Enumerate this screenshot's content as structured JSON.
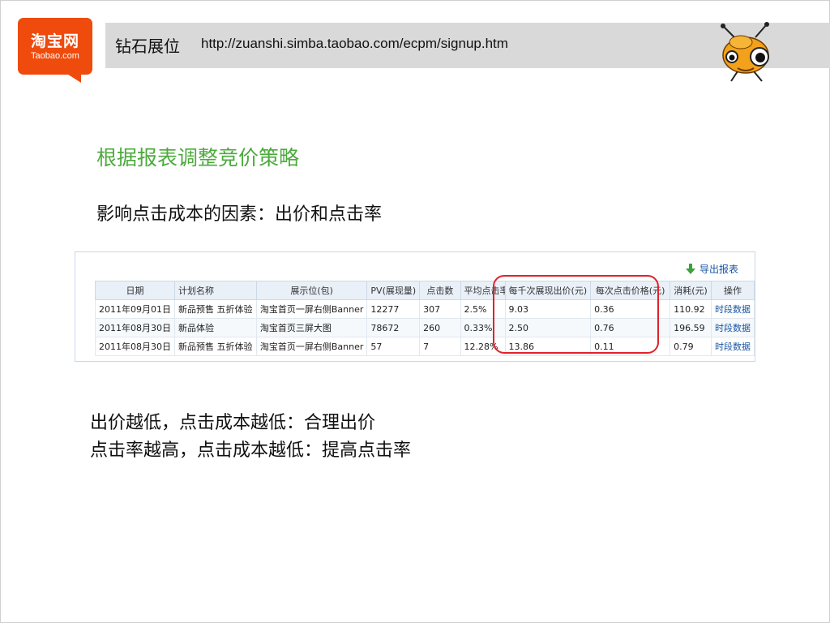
{
  "header": {
    "logo_cn": "淘宝网",
    "logo_en": "Taobao.com",
    "title": "钻石展位",
    "url": "http://zuanshi.simba.taobao.com/ecpm/signup.htm"
  },
  "slide": {
    "heading": "根据报表调整竞价策略",
    "subheading": "影响点击成本的因素：出价和点击率",
    "bottom_line1": "出价越低，点击成本越低：合理出价",
    "bottom_line2": "点击率越高，点击成本越低：提高点击率"
  },
  "report": {
    "export_label": "导出报表",
    "columns": [
      "日期",
      "计划名称",
      "展示位(包)",
      "PV(展现量)",
      "点击数",
      "平均点击率",
      "每千次展现出价(元)",
      "每次点击价格(元)",
      "消耗(元)",
      "操作"
    ],
    "rows": [
      [
        "2011年09月01日",
        "新品预售 五折体验",
        "淘宝首页一屏右侧Banner",
        "12277",
        "307",
        "2.5%",
        "9.03",
        "0.36",
        "110.92",
        "时段数据"
      ],
      [
        "2011年08月30日",
        "新品体验",
        "淘宝首页三屏大图",
        "78672",
        "260",
        "0.33%",
        "2.50",
        "0.76",
        "196.59",
        "时段数据"
      ],
      [
        "2011年08月30日",
        "新品预售 五折体验",
        "淘宝首页一屏右侧Banner",
        "57",
        "7",
        "12.28%",
        "13.86",
        "0.11",
        "0.79",
        "时段数据"
      ]
    ]
  },
  "colors": {
    "brand_orange": "#ee4b0d",
    "heading_green": "#4caa3c",
    "highlight_red": "#e0222a",
    "link_blue": "#1a55a3"
  }
}
